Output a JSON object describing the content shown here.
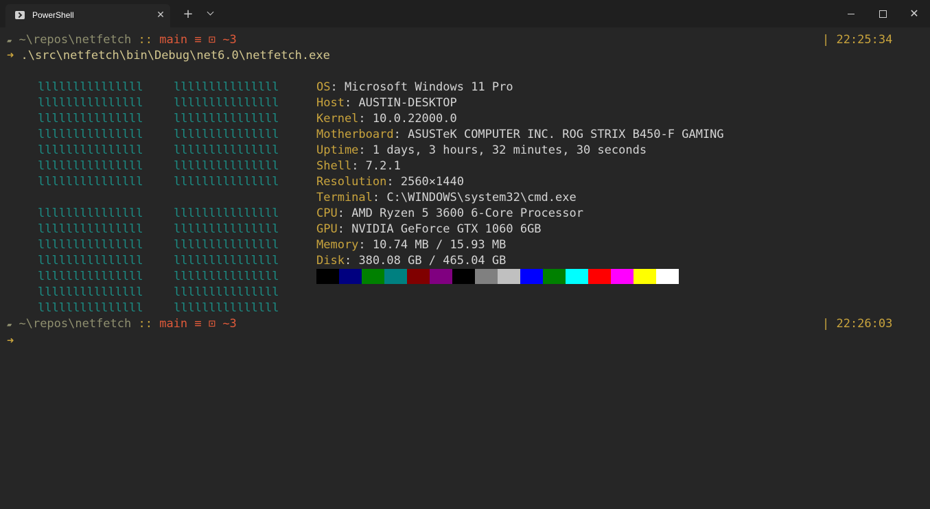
{
  "window": {
    "tab_title": "PowerShell",
    "tab_icon": "powershell-icon",
    "close_tab_glyph": "✕",
    "new_tab_glyph": "+",
    "close_window_glyph": "✕"
  },
  "prompt1": {
    "path": "~\\repos\\netfetch",
    "sep": " :: ",
    "branch": "main ≡ ⊡ ~3",
    "time": "| 22:25:34",
    "command": ".\\src\\netfetch\\bin\\Debug\\net6.0\\netfetch.exe"
  },
  "logo_text": "lllllllllllllll",
  "info": [
    {
      "key": "OS",
      "value": "Microsoft Windows 11 Pro"
    },
    {
      "key": "Host",
      "value": "AUSTIN-DESKTOP"
    },
    {
      "key": "Kernel",
      "value": "10.0.22000.0"
    },
    {
      "key": "Motherboard",
      "value": "ASUSTeK COMPUTER INC. ROG STRIX B450-F GAMING"
    },
    {
      "key": "Uptime",
      "value": "1 days, 3 hours, 32 minutes, 30 seconds"
    },
    {
      "key": "Shell",
      "value": "7.2.1"
    },
    {
      "key": "Resolution",
      "value": "2560×1440"
    },
    {
      "key": "Terminal",
      "value": "C:\\WINDOWS\\system32\\cmd.exe"
    },
    {
      "key": "CPU",
      "value": "AMD Ryzen 5 3600 6-Core Processor"
    },
    {
      "key": "GPU",
      "value": "NVIDIA GeForce GTX 1060 6GB"
    },
    {
      "key": "Memory",
      "value": "10.74 MB / 15.93 MB"
    },
    {
      "key": "Disk",
      "value": "380.08 GB / 465.04 GB"
    }
  ],
  "palette": [
    "#000000",
    "#000080",
    "#008000",
    "#008080",
    "#800000",
    "#800080",
    "#000000",
    "#808080",
    "#c0c0c0",
    "#0000ff",
    "#008000",
    "#00ffff",
    "#ff0000",
    "#ff00ff",
    "#ffff00",
    "#ffffff"
  ],
  "prompt2": {
    "path": "~\\repos\\netfetch",
    "sep": " :: ",
    "branch": "main ≡ ⊡ ~3",
    "time": "| 22:26:03"
  },
  "glyphs": {
    "arrow": "➜",
    "folder": "▰"
  }
}
